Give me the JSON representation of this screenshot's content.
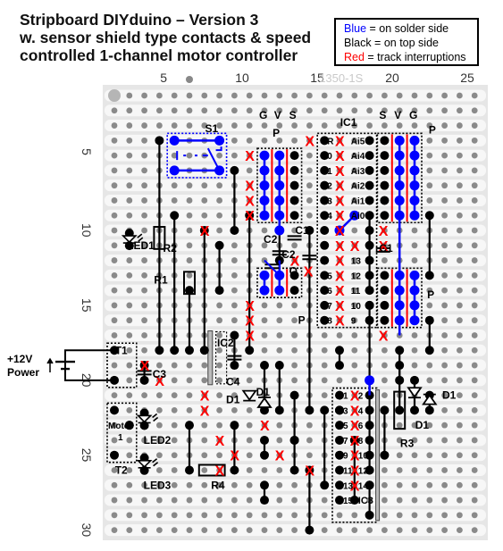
{
  "title": {
    "lines": [
      "Stripboard DIYduino – Version 3",
      "w. sensor shield type contacts & speed",
      "controlled 1-channel motor controller"
    ]
  },
  "legend": {
    "blue_word": "Blue",
    "blue_rest": " = on solder side",
    "black_word": "Black",
    "black_rest": " = on top side",
    "red_word": "Red",
    "red_rest": " = track interruptions"
  },
  "colors": {
    "solder_side": "#0000ff",
    "top_side": "#000000",
    "track_cut": "#ff0000",
    "board_bg": "#e6e6e6",
    "strip": "#f7f7f7",
    "hole": "#8a8a8a"
  },
  "board": {
    "columns": 25,
    "rows": 30,
    "column_labels": [
      "5",
      "10",
      "15",
      "20",
      "25"
    ],
    "row_labels": [
      "5",
      "10",
      "15",
      "20",
      "25",
      "30"
    ],
    "silkscreen_text": "1350-1S"
  },
  "power": {
    "label_line1": "+12V",
    "label_line2": "Power"
  },
  "components": {
    "labels": [
      {
        "text": "S1",
        "col": 7.4,
        "row": 3.2
      },
      {
        "text": "G",
        "col": 11,
        "row": 2.3
      },
      {
        "text": "V",
        "col": 12,
        "row": 2.3
      },
      {
        "text": "S",
        "col": 13,
        "row": 2.3
      },
      {
        "text": "P",
        "col": 11.9,
        "row": 3.5
      },
      {
        "text": "IC1",
        "col": 16.4,
        "row": 2.8
      },
      {
        "text": "S",
        "col": 19,
        "row": 2.3
      },
      {
        "text": "V",
        "col": 20,
        "row": 2.3
      },
      {
        "text": "G",
        "col": 21,
        "row": 2.3
      },
      {
        "text": "P",
        "col": 22.3,
        "row": 3.3
      },
      {
        "text": "LED1",
        "col": 2.2,
        "row": 11.0
      },
      {
        "text": "R2",
        "col": 4.6,
        "row": 11.2
      },
      {
        "text": "R1",
        "col": 4.0,
        "row": 13.3
      },
      {
        "text": "C2",
        "col": 11.3,
        "row": 10.6
      },
      {
        "text": "C1",
        "col": 13.4,
        "row": 10.0
      },
      {
        "text": "C2",
        "col": 12.5,
        "row": 11.6
      },
      {
        "text": "Q",
        "col": 13.0,
        "row": 12.7
      },
      {
        "text": "P",
        "col": 13.6,
        "row": 16.0
      },
      {
        "text": "C1",
        "col": 19.0,
        "row": 11.2
      },
      {
        "text": "P",
        "col": 22.2,
        "row": 14.3
      },
      {
        "text": "T1",
        "col": 1.4,
        "row": 18.0
      },
      {
        "text": "IC2",
        "col": 8.2,
        "row": 17.5
      },
      {
        "text": "C3",
        "col": 3.9,
        "row": 19.6
      },
      {
        "text": "C4",
        "col": 8.8,
        "row": 20.1
      },
      {
        "text": "D1",
        "col": 8.8,
        "row": 21.3
      },
      {
        "text": "D1",
        "col": 10.8,
        "row": 20.8
      },
      {
        "text": "LED2",
        "col": 3.3,
        "row": 24.0
      },
      {
        "text": "LED3",
        "col": 3.3,
        "row": 27.0
      },
      {
        "text": "T2",
        "col": 1.4,
        "row": 26.0
      },
      {
        "text": "R4",
        "col": 7.8,
        "row": 27.0
      },
      {
        "text": "D1",
        "col": 23.2,
        "row": 21.0
      },
      {
        "text": "D1",
        "col": 21.4,
        "row": 23.0
      },
      {
        "text": "R3",
        "col": 20.4,
        "row": 24.2
      }
    ],
    "motor_label_line1": "Motor",
    "motor_label_line2": "1",
    "ic1_pins_left": [
      "R",
      "0",
      "1",
      "2",
      "3",
      "4",
      "",
      "",
      "",
      "5",
      "6",
      "7",
      "8"
    ],
    "ic1_pins_right": [
      "Ai5",
      "Ai4",
      "Ai3",
      "Ai2",
      "Ai1",
      "Ai0",
      "",
      "",
      "13",
      "12",
      "11",
      "10",
      "9"
    ],
    "ic3_pins_left": [
      "1",
      "3",
      "5",
      "7",
      "9",
      "11",
      "13",
      "15"
    ],
    "ic3_pins_right": [
      "2",
      "4",
      "6",
      "8",
      "10",
      "12",
      "14",
      ""
    ],
    "ic3_label": "IC3"
  }
}
